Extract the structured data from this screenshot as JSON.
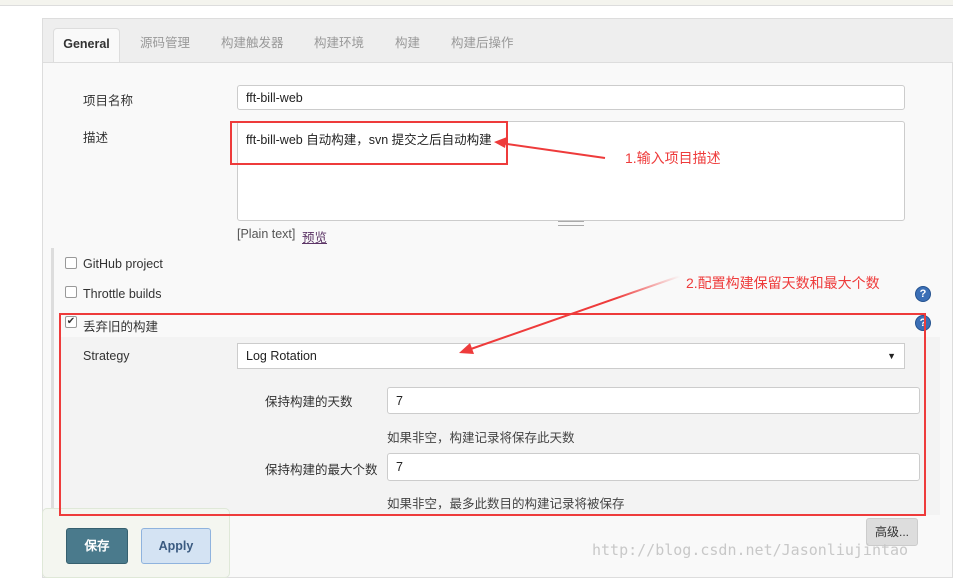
{
  "tabs": [
    {
      "label": "General",
      "active": true
    },
    {
      "label": "源码管理"
    },
    {
      "label": "构建触发器"
    },
    {
      "label": "构建环境"
    },
    {
      "label": "构建"
    },
    {
      "label": "构建后操作"
    }
  ],
  "project_name": {
    "label": "项目名称",
    "value": "fft-bill-web"
  },
  "description": {
    "label": "描述",
    "value": "fft-bill-web 自动构建，svn 提交之后自动构建",
    "format": "[Plain text]",
    "preview": "预览"
  },
  "options": {
    "github": "GitHub project",
    "throttle": "Throttle builds",
    "discard": "丢弃旧的构建",
    "discard_checked": true,
    "github_checked": false,
    "throttle_checked": false
  },
  "strategy": {
    "label": "Strategy",
    "value": "Log Rotation"
  },
  "days": {
    "label": "保持构建的天数",
    "value": "7",
    "help": "如果非空，构建记录将保存此天数"
  },
  "max": {
    "label": "保持构建的最大个数",
    "value": "7",
    "help": "如果非空，最多此数目的构建记录将被保存"
  },
  "advanced": "高级...",
  "save": "保存",
  "apply": "Apply",
  "annotations": {
    "note1": "1.输入项目描述",
    "note2": "2.配置构建保留天数和最大个数",
    "color": "#ee3b3b"
  },
  "watermark": "http://blog.csdn.net/Jasonliujintao"
}
